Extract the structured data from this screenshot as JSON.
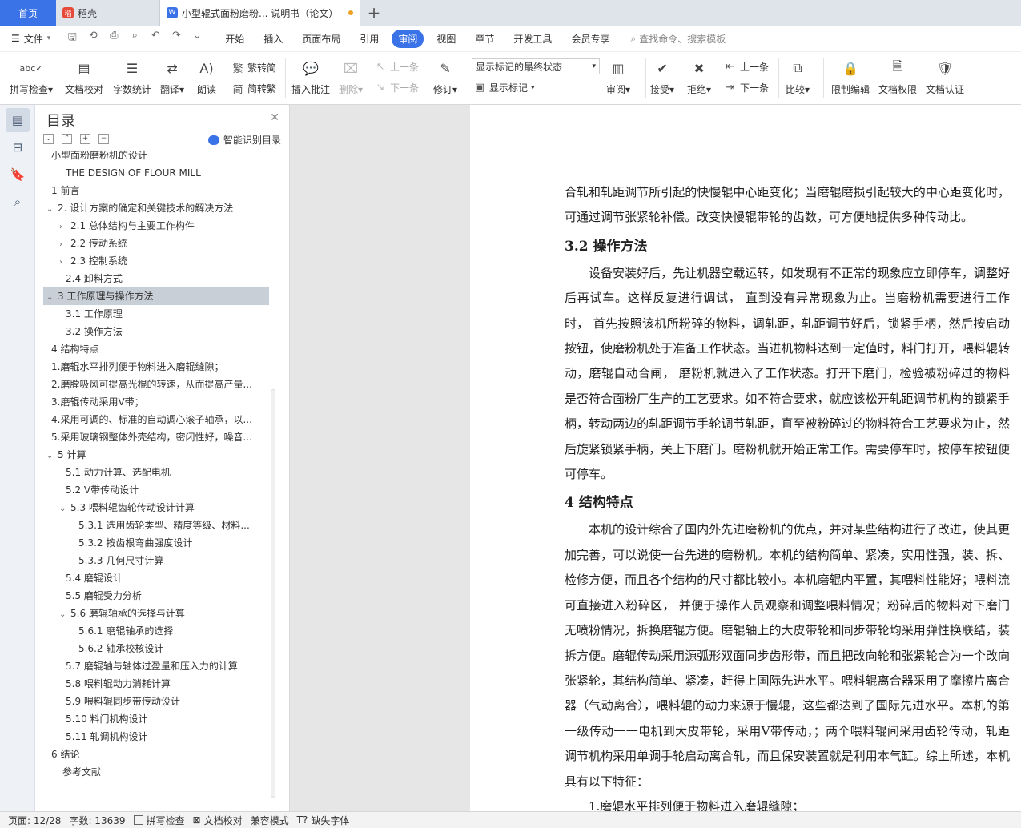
{
  "tabs": {
    "home": "首页",
    "second": "稻壳",
    "doc": "小型辊式面粉磨粉... 说明书（论文）",
    "plus": "+"
  },
  "menubar": {
    "file": "文件",
    "items": [
      "开始",
      "插入",
      "页面布局",
      "引用",
      "审阅",
      "视图",
      "章节",
      "开发工具",
      "会员专享"
    ],
    "active_index": 4,
    "search": "查找命令、搜索模板"
  },
  "ribbon": {
    "spellcheck": "拼写检查",
    "doc_proof": "文档校对",
    "word_count": "字数统计",
    "translate": "翻译",
    "read_aloud": "朗读",
    "to_traditional": "繁转简",
    "to_simplified": "简转繁",
    "insert_comment": "插入批注",
    "delete": "删除",
    "prev_comment": "上一条",
    "next_comment": "下一条",
    "track": "修订",
    "markup_state": "显示标记的最终状态",
    "show_markup": "显示标记",
    "review": "审阅",
    "accept": "接受",
    "reject": "拒绝",
    "prev_change": "上一条",
    "next_change": "下一条",
    "compare": "比较",
    "restrict": "限制编辑",
    "doc_permission": "文档权限",
    "doc_auth": "文档认证"
  },
  "toc": {
    "title": "目录",
    "smart": "智能识别目录",
    "selected_index": 8,
    "items": [
      {
        "text": "小型面粉磨粉机的设计",
        "level": 1,
        "arrow": ""
      },
      {
        "text": "THE DESIGN OF FLOUR MILL",
        "level": 2,
        "arrow": ""
      },
      {
        "text": "1   前言",
        "level": 1,
        "arrow": ""
      },
      {
        "text": "2.  设计方案的确定和关键技术的解决方法",
        "level": 0,
        "arrow": "v"
      },
      {
        "text": "2.1   总体结构与主要工作构件",
        "level": 1,
        "arrow": ">"
      },
      {
        "text": "2.2   传动系统",
        "level": 1,
        "arrow": ">"
      },
      {
        "text": "2.3   控制系统",
        "level": 1,
        "arrow": ">"
      },
      {
        "text": "2.4   卸料方式",
        "level": 2,
        "arrow": ""
      },
      {
        "text": "3   工作原理与操作方法",
        "level": 0,
        "arrow": "v"
      },
      {
        "text": "3.1   工作原理",
        "level": 2,
        "arrow": ""
      },
      {
        "text": "3.2   操作方法",
        "level": 2,
        "arrow": ""
      },
      {
        "text": "4   结构特点",
        "level": 1,
        "arrow": ""
      },
      {
        "text": "1.磨辊水平排列便于物料进入磨辊缝隙；",
        "level": -1,
        "arrow": ""
      },
      {
        "text": "2.磨膛吸风可提高光棍的转速，从而提高产量...",
        "level": -1,
        "arrow": ""
      },
      {
        "text": "3.磨辊传动采用V带；",
        "level": -1,
        "arrow": ""
      },
      {
        "text": "4.采用可调的、标准的自动调心滚子轴承，以...",
        "level": -1,
        "arrow": ""
      },
      {
        "text": "5.采用玻璃钢整体外壳结构，密闭性好，噪音...",
        "level": -1,
        "arrow": ""
      },
      {
        "text": "5 计算",
        "level": 0,
        "arrow": "v"
      },
      {
        "text": "5.1  动力计算、选配电机",
        "level": 2,
        "arrow": ""
      },
      {
        "text": "5.2 V带传动设计",
        "level": 2,
        "arrow": ""
      },
      {
        "text": "5.3    喂料辊齿轮传动设计计算",
        "level": 1,
        "arrow": "v"
      },
      {
        "text": "5.3.1  选用齿轮类型、精度等级、材料...",
        "level": 3,
        "arrow": ""
      },
      {
        "text": "5.3.2  按齿根弯曲强度设计",
        "level": 3,
        "arrow": ""
      },
      {
        "text": "5.3.3  几何尺寸计算",
        "level": 3,
        "arrow": ""
      },
      {
        "text": "5.4  磨辊设计",
        "level": 2,
        "arrow": ""
      },
      {
        "text": "5.5  磨辊受力分析",
        "level": 2,
        "arrow": ""
      },
      {
        "text": "5.6  磨辊轴承的选择与计算",
        "level": 1,
        "arrow": "v"
      },
      {
        "text": "5.6.1  磨辊轴承的选择",
        "level": 3,
        "arrow": ""
      },
      {
        "text": "5.6.2  轴承校核设计",
        "level": 3,
        "arrow": ""
      },
      {
        "text": "5.7  磨辊轴与轴体过盈量和压入力的计算",
        "level": 2,
        "arrow": ""
      },
      {
        "text": "5.8  喂料辊动力消耗计算",
        "level": 2,
        "arrow": ""
      },
      {
        "text": "5.9 喂料辊同步带传动设计",
        "level": 2,
        "arrow": ""
      },
      {
        "text": "5.10  料门机构设计",
        "level": 2,
        "arrow": ""
      },
      {
        "text": "5.11  轧调机构设计",
        "level": 2,
        "arrow": ""
      },
      {
        "text": "6   结论",
        "level": 1,
        "arrow": ""
      },
      {
        "text": "参考文献",
        "level": 1.5,
        "arrow": ""
      }
    ]
  },
  "document": {
    "p1": "合轧和轧距调节所引起的快慢辊中心距变化；当磨辊磨损引起较大的中心距变化时，可通过调节张紧轮补偿。改变快慢辊带轮的齿数，可方便地提供多种传动比。",
    "h1": "3.2   操作方法",
    "p2": "设备安装好后，先让机器空载运转，如发现有不正常的现象应立即停车，调整好后再试车。这样反复进行调试，  直到没有异常现象为止。当磨粉机需要进行工作时，  首先按照该机所粉碎的物料，调轧距，轧距调节好后，锁紧手柄，然后按启动按钮，使磨粉机处于准备工作状态。当进机物料达到一定值时，料门打开，喂料辊转动，磨辊自动合闸，  磨粉机就进入了工作状态。打开下磨门，检验被粉碎过的物料是否符合面粉厂生产的工艺要求。如不符合要求，就应该松开轧距调节机构的锁紧手柄，转动两边的轧距调节手轮调节轧距，直至被粉碎过的物料符合工艺要求为止，然后旋紧锁紧手柄，关上下磨门。磨粉机就开始正常工作。需要停车时，按停车按钮便可停车。",
    "h2": "4   结构特点",
    "p3": "本机的设计综合了国内外先进磨粉机的优点，并对某些结构进行了改进，使其更加完善，可以说使一台先进的磨粉机。本机的结构简单、紧凑，实用性强，装、拆、检修方便，而且各个结构的尺寸都比较小。本机磨辊内平置，其喂料性能好；喂料流可直接进入粉碎区，  并便于操作人员观察和调整喂料情况；粉碎后的物料对下磨门无喷粉情况，拆换磨辊方便。磨辊轴上的大皮带轮和同步带轮均采用弹性换联结，装拆方便。磨辊传动采用源弧形双面同步齿形带，而且把改向轮和张紧轮合为一个改向张紧轮，其结构简单、紧凑，赶得上国际先进水平。喂料辊离合器采用了摩擦片离合器（气动离合），喂料辊的动力来源于慢辊，这些都达到了国际先进水平。本机的第一级传动一一电机到大皮带轮，采用V带传动，；两个喂料辊间采用齿轮传动，轧距调节机构采用单调手轮启动离合轧，而且保安装置就是利用本气缸。综上所述，本机具有以下特征：",
    "l1": "1.磨辊水平排列便于物料进入磨辊缝隙；"
  },
  "status": {
    "page": "页面: 12/28",
    "words": "字数: 13639",
    "spell": "拼写检查",
    "proof": "文档校对",
    "compat": "兼容模式",
    "missing_font": "缺失字体"
  }
}
